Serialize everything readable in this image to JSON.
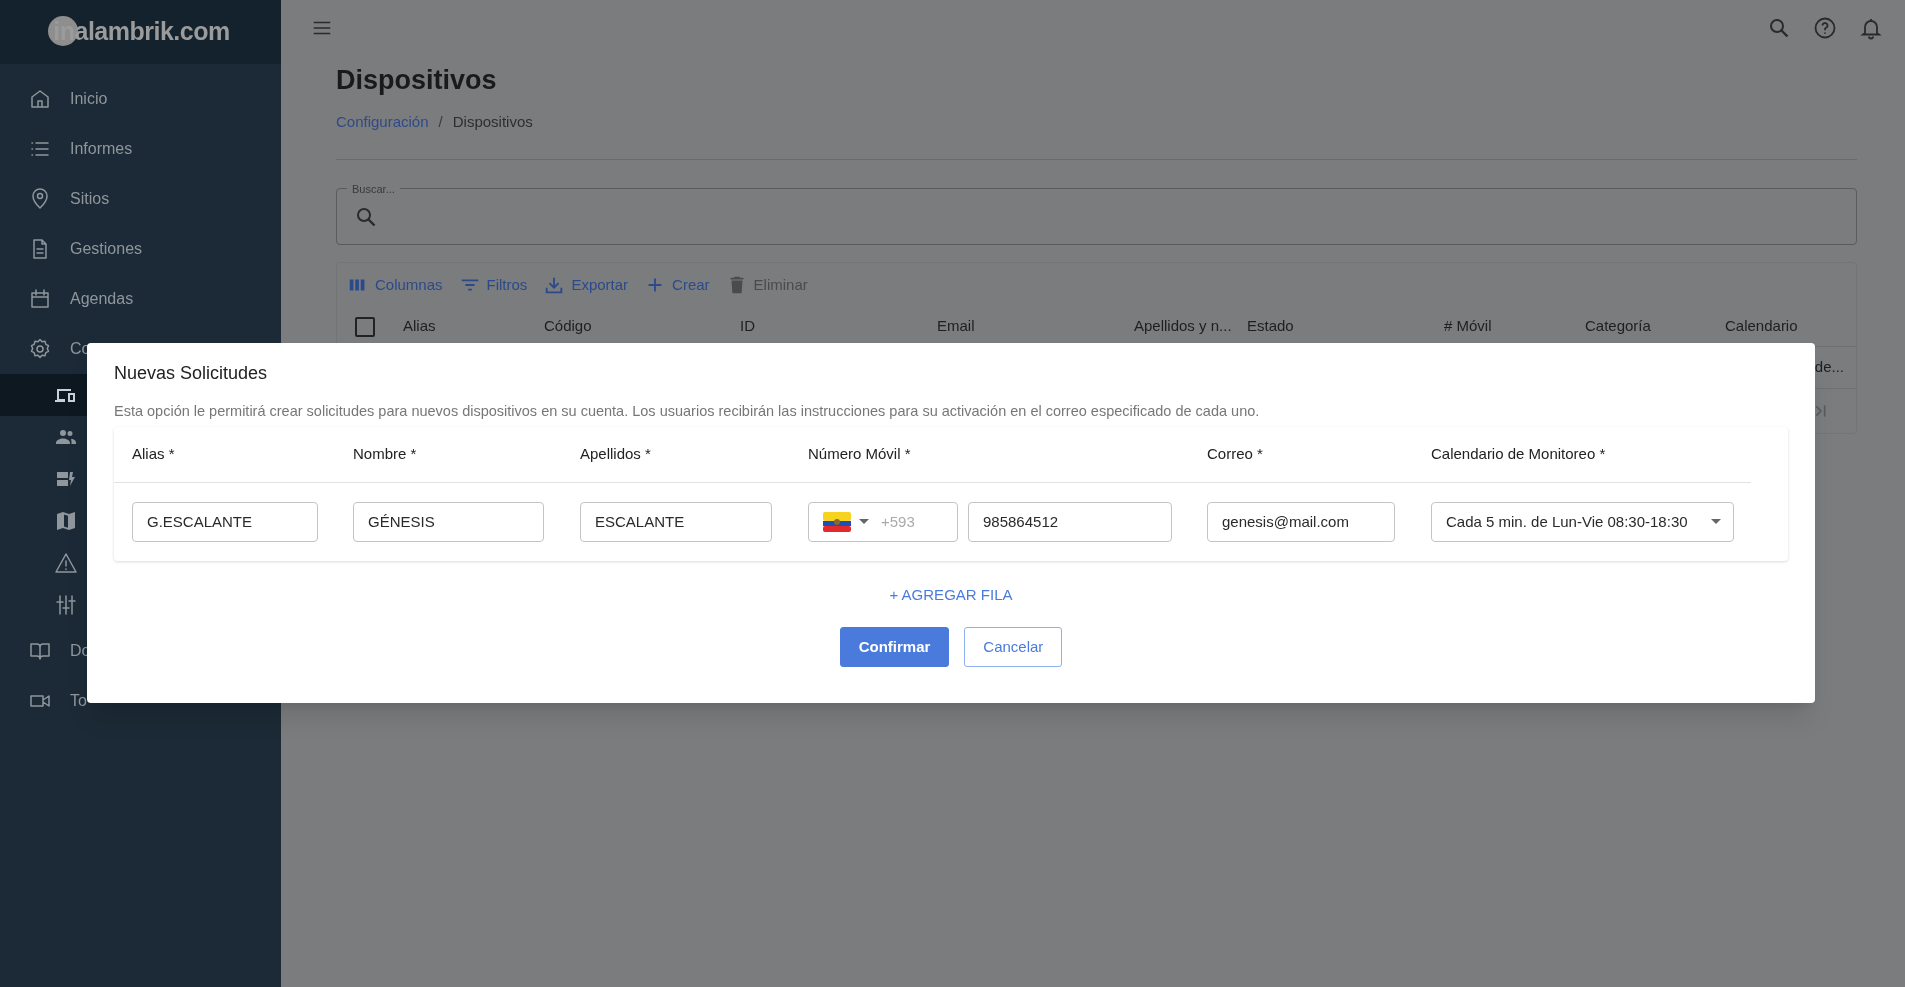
{
  "logo": {
    "text": "inalambrik.com"
  },
  "sidebar": {
    "items": [
      {
        "label": "Inicio"
      },
      {
        "label": "Informes"
      },
      {
        "label": "Sitios"
      },
      {
        "label": "Gestiones"
      },
      {
        "label": "Agendas"
      },
      {
        "label": "Co",
        "children": [
          {
            "selected": true
          },
          {
            "selected": false
          },
          {
            "selected": false
          },
          {
            "selected": false
          },
          {
            "selected": false
          },
          {
            "selected": false
          }
        ]
      },
      {
        "label": "Do"
      },
      {
        "label": "To"
      }
    ]
  },
  "page": {
    "title": "Dispositivos",
    "breadcrumb": [
      {
        "label": "Configuración",
        "link": true
      },
      {
        "label": "Dispositivos",
        "link": false
      }
    ],
    "breadcrumb_separator": "/"
  },
  "search": {
    "label": "Buscar..."
  },
  "table": {
    "toolbar": [
      {
        "label": "Columnas",
        "disabled": false
      },
      {
        "label": "Filtros",
        "disabled": false
      },
      {
        "label": "Exportar",
        "disabled": false
      },
      {
        "label": "Crear",
        "disabled": false
      },
      {
        "label": "Eliminar",
        "disabled": true
      }
    ],
    "select_all": {
      "checked": false
    },
    "columns": [
      "Alias",
      "Código",
      "ID",
      "Email",
      "Apellidos y n...",
      "Estado",
      "# Móvil",
      "Categoría",
      "Calendario"
    ],
    "rows": [
      {
        "calendario": "de..."
      }
    ]
  },
  "dialog": {
    "title": "Nuevas Solicitudes",
    "description": "Esta opción le permitirá crear solicitudes para nuevos dispositivos en su cuenta. Los usuarios recibirán las instrucciones para su activación en el correo especificado de cada uno.",
    "columns": [
      "Alias *",
      "Nombre *",
      "Apellidos *",
      "Número Móvil *",
      "Correo *",
      "Calendario de Monitoreo *"
    ],
    "rows": [
      {
        "alias": "G.ESCALANTE",
        "nombre": "GÉNESIS",
        "apellidos": "ESCALANTE",
        "country_code": "+593",
        "movil": "985864512",
        "correo": "genesis@mail.com",
        "calendario": "Cada 5 min. de Lun-Vie 08:30-18:30"
      }
    ],
    "add_row": "+ AGREGAR FILA",
    "buttons": [
      {
        "label": "Confirmar",
        "kind": "primary"
      },
      {
        "label": "Cancelar",
        "kind": "secondary"
      }
    ]
  }
}
